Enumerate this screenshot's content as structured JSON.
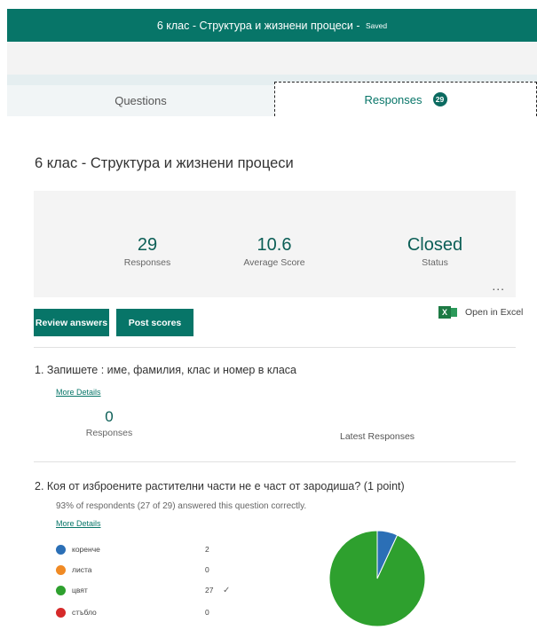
{
  "header": {
    "title": "6 клас - Структура и жизнени процеси",
    "separator": " - ",
    "saved": "Saved"
  },
  "tabs": {
    "questions": "Questions",
    "responses": "Responses",
    "responses_badge": "29"
  },
  "summary": {
    "form_title": "6 клас - Структура и жизнени процеси",
    "responses_value": "29",
    "responses_label": "Responses",
    "avg_value": "10.6",
    "avg_label": "Average Score",
    "status_value": "Closed",
    "status_label": "Status",
    "more_icon": "more-icon",
    "more_glyph": "..."
  },
  "actions": {
    "review": "Review answers",
    "post": "Post scores",
    "excel": "Open in Excel",
    "excel_icon_glyph": "X"
  },
  "questions": [
    {
      "title": "1. Запишете : име, фамилия, клас и номер в класа",
      "more_details": "More Details",
      "count": "0",
      "count_label": "Responses",
      "latest_label": "Latest Responses"
    },
    {
      "title": "2. Коя от изброените растителни части не е част от зародиша? (1 point)",
      "subtitle": "93% of respondents (27 of 29) answered this question correctly.",
      "more_details": "More Details",
      "options": [
        {
          "label": "коренче",
          "count": "2",
          "color": "#2b6fb6",
          "correct": false
        },
        {
          "label": "листа",
          "count": "0",
          "color": "#f08a24",
          "correct": false
        },
        {
          "label": "цвят",
          "count": "27",
          "color": "#2ea02e",
          "correct": true,
          "check": "✓"
        },
        {
          "label": "стъбло",
          "count": "0",
          "color": "#d62a2a",
          "correct": false
        }
      ]
    }
  ],
  "chart_data": {
    "type": "pie",
    "categories": [
      "коренче",
      "листа",
      "цвят",
      "стъбло"
    ],
    "values": [
      2,
      0,
      27,
      0
    ],
    "colors": [
      "#2b6fb6",
      "#f08a24",
      "#2ea02e",
      "#d62a2a"
    ]
  }
}
